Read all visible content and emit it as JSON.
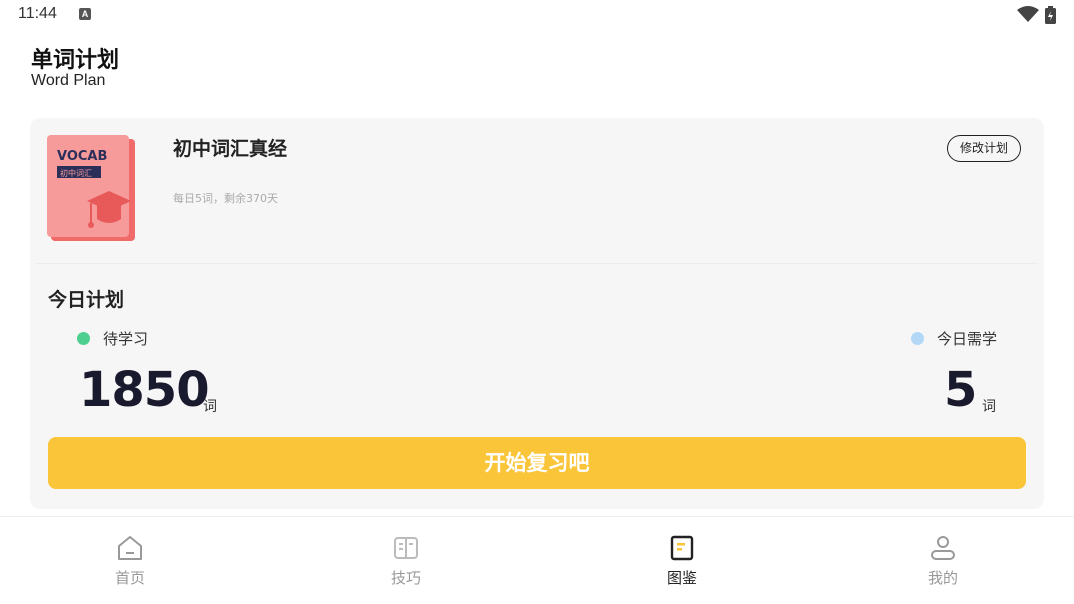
{
  "status_bar": {
    "time": "11:44",
    "notification_icon": "a-icon"
  },
  "header": {
    "title": "单词计划",
    "subtitle": "Word Plan"
  },
  "plan": {
    "cover": {
      "brand_text": "VOCAB",
      "tag_text": "初中词汇",
      "color": "#f79a9a"
    },
    "book_title": "初中词汇真经",
    "meta": "每日5词，剩余370天",
    "modify_label": "修改计划"
  },
  "today": {
    "title": "今日计划",
    "pending_label": "待学习",
    "pending_value": "1850",
    "pending_unit": "词",
    "pending_color": "#4fcf8f",
    "needed_label": "今日需学",
    "needed_value": "5",
    "needed_unit": "词",
    "needed_color": "#b3d8f7",
    "start_label": "开始复习吧",
    "accent": "#fbc53a"
  },
  "nav": {
    "items": [
      {
        "label": "首页",
        "icon": "home-icon"
      },
      {
        "label": "技巧",
        "icon": "book-open-icon"
      },
      {
        "label": "图鉴",
        "icon": "catalog-icon",
        "active": true
      },
      {
        "label": "我的",
        "icon": "profile-icon"
      }
    ]
  }
}
